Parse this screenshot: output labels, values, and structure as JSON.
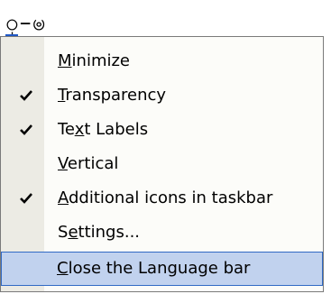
{
  "language_indicator": {
    "text": "ဝှ–ၑ"
  },
  "menu": {
    "items": [
      {
        "pre": "",
        "mnemonic": "M",
        "post": "inimize",
        "checked": false,
        "highlighted": false
      },
      {
        "pre": "",
        "mnemonic": "T",
        "post": "ransparency",
        "checked": true,
        "highlighted": false
      },
      {
        "pre": "Te",
        "mnemonic": "x",
        "post": "t Labels",
        "checked": true,
        "highlighted": false
      },
      {
        "pre": "",
        "mnemonic": "V",
        "post": "ertical",
        "checked": false,
        "highlighted": false
      },
      {
        "pre": "",
        "mnemonic": "A",
        "post": "dditional icons in taskbar",
        "checked": true,
        "highlighted": false
      },
      {
        "pre": "S",
        "mnemonic": "e",
        "post": "ttings...",
        "checked": false,
        "highlighted": false
      },
      {
        "pre": "",
        "mnemonic": "C",
        "post": "lose the Language bar",
        "checked": false,
        "highlighted": true
      }
    ]
  },
  "colors": {
    "gutter": "#ecebe4",
    "menu_background": "#fcfcf9",
    "highlight_fill": "#c1d2ee",
    "highlight_border": "#316ac5",
    "check_mark": "#000000"
  },
  "icons": {
    "check": "check-icon"
  }
}
